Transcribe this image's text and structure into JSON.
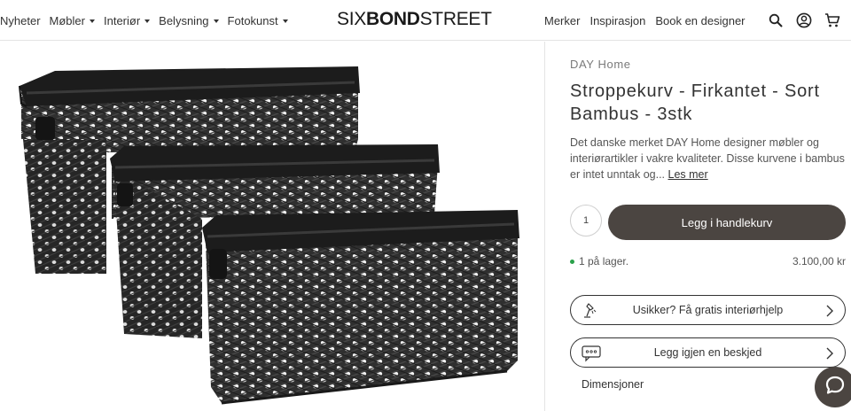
{
  "header": {
    "nav_left": [
      {
        "label": "Nyheter",
        "has_caret": false
      },
      {
        "label": "Møbler",
        "has_caret": true
      },
      {
        "label": "Interiør",
        "has_caret": true
      },
      {
        "label": "Belysning",
        "has_caret": true
      },
      {
        "label": "Fotokunst",
        "has_caret": true
      }
    ],
    "logo": {
      "part1": "SIX",
      "part2": "BOND",
      "part3": "STREET"
    },
    "nav_right": [
      {
        "label": "Merker"
      },
      {
        "label": "Inspirasjon"
      },
      {
        "label": "Book en designer"
      }
    ],
    "icons": [
      "search-icon",
      "account-icon",
      "cart-icon"
    ]
  },
  "product": {
    "image_alt": "three-black-bamboo-baskets-image",
    "brand": "DAY Home",
    "title": "Stroppekurv - Firkantet - Sort Bambus - 3stk",
    "description": "Det danske merket DAY Home designer møbler og interiørartikler i vakre kvaliteter. Disse kurvene i bambus er intet unntak og...",
    "read_more": "Les mer",
    "quantity": "1",
    "add_to_cart": "Legg i handlekurv",
    "stock": "1 på lager.",
    "price": "3.100,00 kr"
  },
  "actions": {
    "help": "Usikker? Få gratis interiørhjelp",
    "message": "Legg igjen en beskjed",
    "dimensions": "Dimensjoner"
  },
  "colors": {
    "primary_button": "#4b4541",
    "stock_dot": "#2aa14a",
    "basket": "#2b2b2b"
  }
}
